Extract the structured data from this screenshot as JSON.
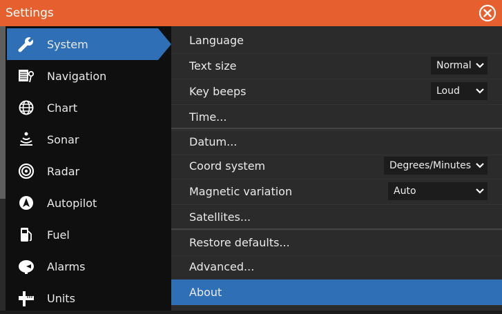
{
  "window": {
    "title": "Settings",
    "accent_color": "#e5602e",
    "close_icon": "close-circle-icon"
  },
  "sidebar": {
    "items": [
      {
        "label": "System",
        "icon": "wrench-icon",
        "active": true
      },
      {
        "label": "Navigation",
        "icon": "navigation-icon",
        "active": false
      },
      {
        "label": "Chart",
        "icon": "globe-icon",
        "active": false
      },
      {
        "label": "Sonar",
        "icon": "sonar-icon",
        "active": false
      },
      {
        "label": "Radar",
        "icon": "radar-icon",
        "active": false
      },
      {
        "label": "Autopilot",
        "icon": "autopilot-icon",
        "active": false
      },
      {
        "label": "Fuel",
        "icon": "fuel-icon",
        "active": false
      },
      {
        "label": "Alarms",
        "icon": "alarm-icon",
        "active": false
      },
      {
        "label": "Units",
        "icon": "units-icon",
        "active": false
      }
    ]
  },
  "settings": {
    "rows": [
      {
        "label": "Language"
      },
      {
        "label": "Text size",
        "value": "Normal"
      },
      {
        "label": "Key beeps",
        "value": "Loud"
      },
      {
        "label": "Time..."
      },
      {
        "label": "Datum..."
      },
      {
        "label": "Coord system",
        "value": "Degrees/Minutes"
      },
      {
        "label": "Magnetic variation",
        "value": "Auto"
      },
      {
        "label": "Satellites..."
      },
      {
        "label": "Restore defaults..."
      },
      {
        "label": "Advanced..."
      },
      {
        "label": "About",
        "active": true
      }
    ]
  },
  "highlight_color": "#2f6fb6"
}
